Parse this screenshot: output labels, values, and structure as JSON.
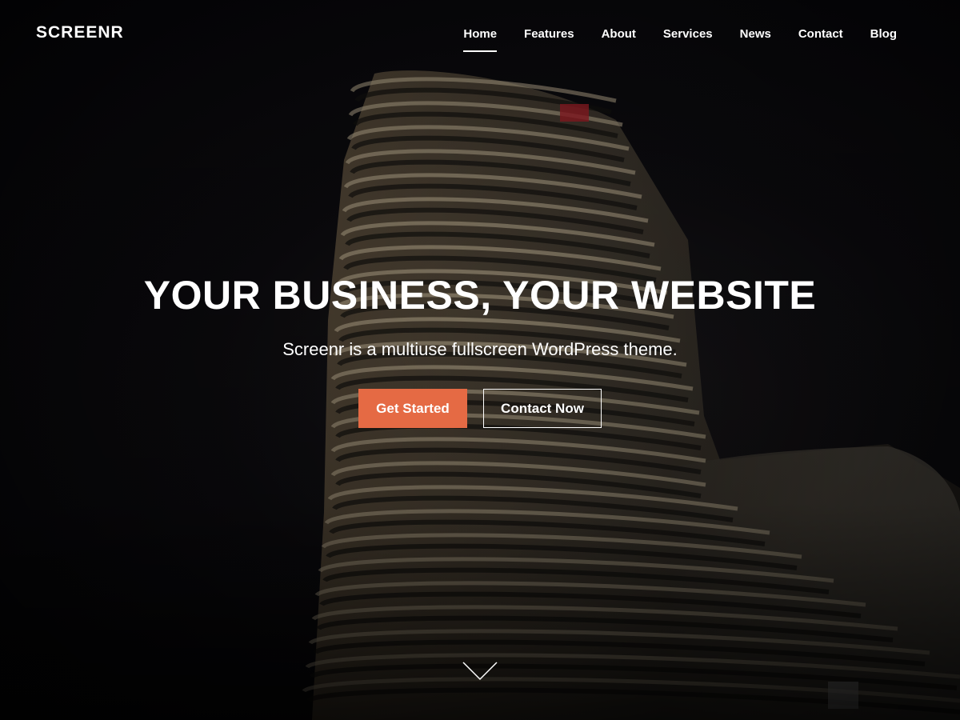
{
  "header": {
    "logo": "SCREENR",
    "nav": [
      {
        "label": "Home",
        "active": true
      },
      {
        "label": "Features",
        "active": false
      },
      {
        "label": "About",
        "active": false
      },
      {
        "label": "Services",
        "active": false
      },
      {
        "label": "News",
        "active": false
      },
      {
        "label": "Contact",
        "active": false
      },
      {
        "label": "Blog",
        "active": false
      }
    ]
  },
  "hero": {
    "title": "YOUR BUSINESS, YOUR WEBSITE",
    "tagline": "Screenr is a multiuse fullscreen WordPress theme.",
    "primary_button": "Get Started",
    "secondary_button": "Contact Now",
    "scroll_icon": "chevron-down-icon"
  },
  "colors": {
    "accent": "#e56a44",
    "background": "#07070b",
    "text": "#ffffff"
  }
}
